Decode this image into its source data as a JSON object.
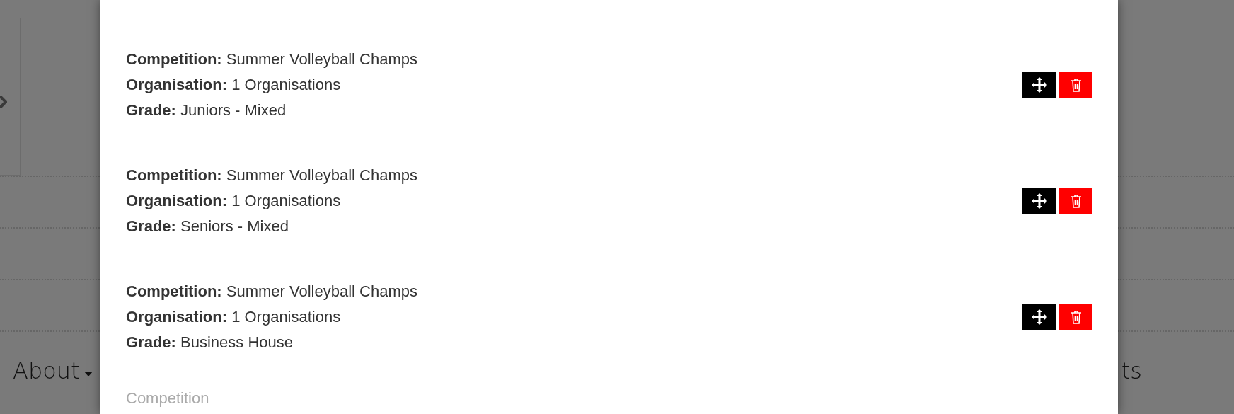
{
  "background": {
    "nav_items": [
      {
        "label": "About",
        "has_dropdown": true
      },
      {
        "label": "ts",
        "has_dropdown": false
      }
    ]
  },
  "modal": {
    "entries": [
      {
        "lines": [
          "**Competition:** Summer Volleyball Champs",
          "**Organisation:** 1 Organisations",
          "**Grade:** Juniors - Mixed"
        ]
      },
      {
        "lines": [
          "**Competition:** Summer Volleyball Champs",
          "**Organisation:** 1 Organisations",
          "**Grade:** Seniors - Mixed"
        ]
      },
      {
        "lines": [
          "**Competition:** Summer Volleyball Champs",
          "**Organisation:** 1 Organisations",
          "**Grade:** Business House"
        ]
      }
    ],
    "competition_field": {
      "placeholder": "Competition"
    }
  }
}
